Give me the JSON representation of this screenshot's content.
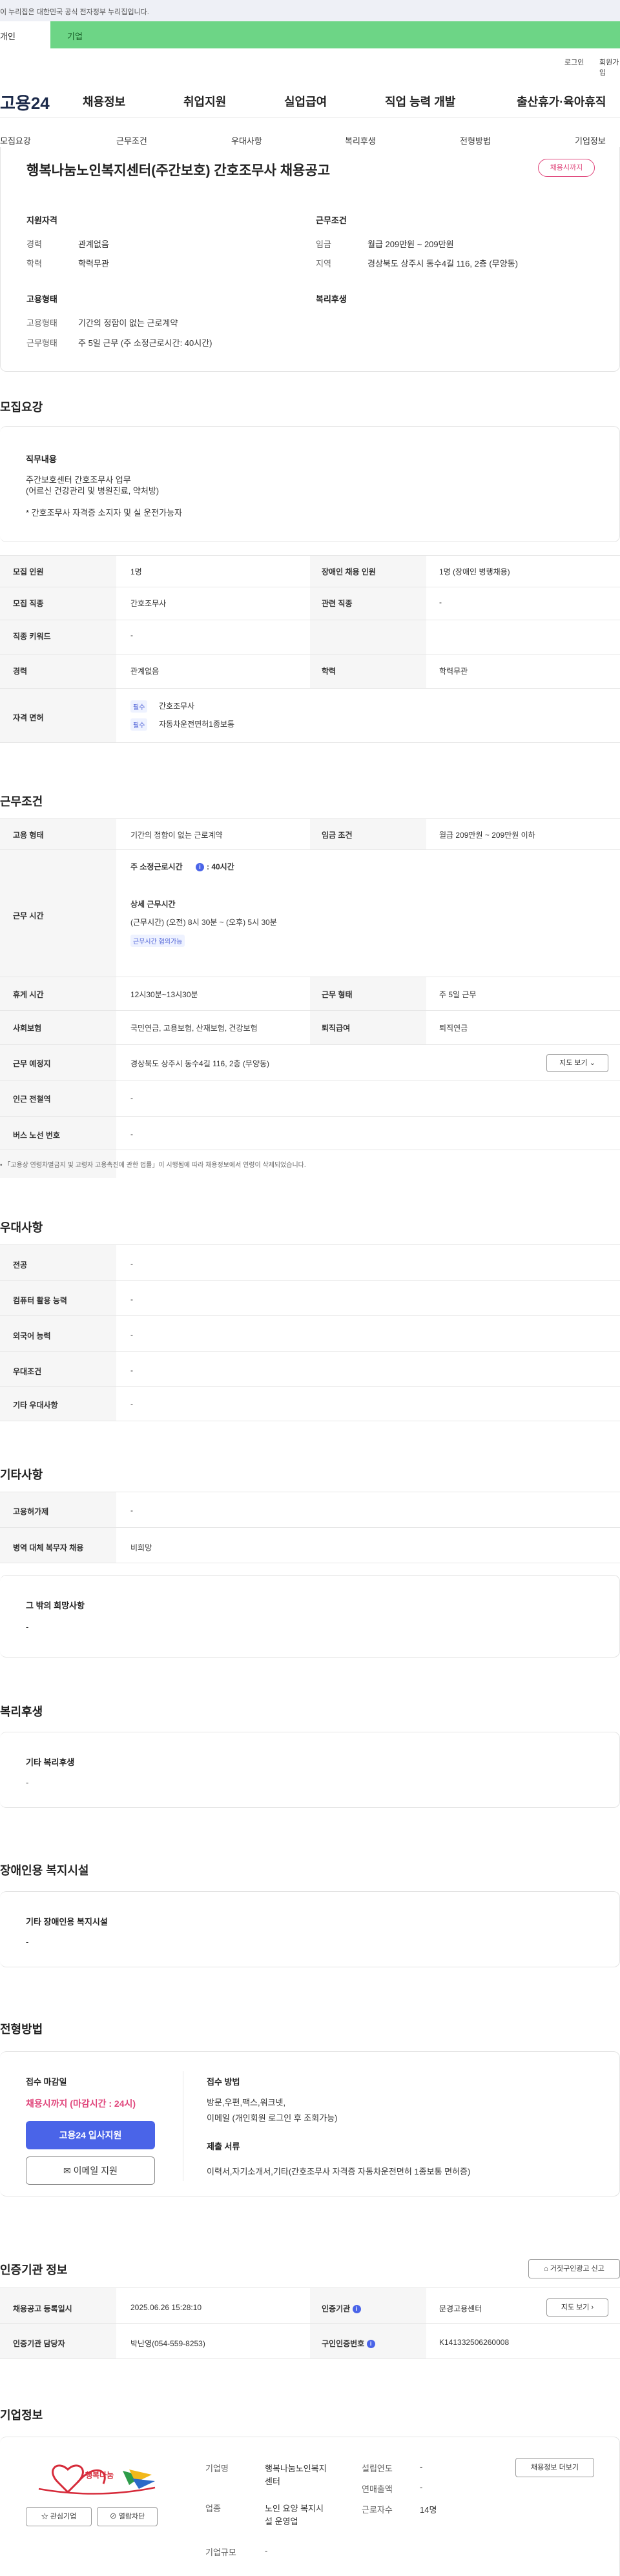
{
  "top_notice": "이 누리집은 대한민국 공식 전자정부 누리집입니다.",
  "tabs": {
    "personal": "개인",
    "company": "기업"
  },
  "util": {
    "login": "로그인",
    "join": "회원가입"
  },
  "logo": "고용24",
  "gnb": [
    "채용정보",
    "취업지원",
    "실업급여",
    "직업 능력 개발",
    "출산휴가·육아휴직"
  ],
  "subnav": [
    "모집요강",
    "근무조건",
    "우대사항",
    "복리후생",
    "전형방법",
    "기업정보"
  ],
  "job": {
    "title": "행복나눔노인복지센터(주간보호) 간호조무사 채용공고",
    "status_badge": "채용시까지",
    "qual_title": "지원자격",
    "career_label": "경력",
    "career_value": "관계없음",
    "edu_label": "학력",
    "edu_value": "학력무관",
    "emp_title": "고용형태",
    "emp_type_label": "고용형태",
    "emp_type_value": "기간의 정함이 없는 근로계약",
    "work_form_label": "근무형태",
    "work_form_value": "주 5일 근무 (주 소정근로시간: 40시간)",
    "cond_title": "근무조건",
    "wage_label": "임금",
    "wage_value": "월급 209만원 ~ 209만원",
    "region_label": "지역",
    "region_value": "경상북도 상주시 동수4길 116, 2층 (무양동)",
    "welfare_title": "복리후생"
  },
  "recruit": {
    "title": "모집요강",
    "duty_title": "직무내용",
    "duty_lines": [
      "주간보호센터 간호조무사 업무",
      "(어르신 건강관리 및 병원진료, 약처방)",
      "",
      "* 간호조무사 자격증 소지자 및 실 운전가능자"
    ],
    "rows": {
      "headcount_label": "모집 인원",
      "headcount_value": "1명",
      "disabled_label": "장애인 채용 인원",
      "disabled_value": "1명 (장애인 병행채용)",
      "job_label": "모집 직종",
      "job_value": "간호조무사",
      "related_label": "관련 직종",
      "related_value": "-",
      "keyword_label": "직종 키워드",
      "keyword_value": "-",
      "career_label": "경력",
      "career_value": "관계없음",
      "edu_label": "학력",
      "edu_value": "학력무관",
      "license_label": "자격 면허",
      "license_items": [
        {
          "badge": "필수",
          "name": "간호조무사"
        },
        {
          "badge": "필수",
          "name": "자동차운전면허1종보통"
        }
      ]
    }
  },
  "condition": {
    "title": "근무조건",
    "emp_label": "고용 형태",
    "emp_value": "기간의 정함이 없는 근로계약",
    "wage_label": "임금 조건",
    "wage_value": "월급 209만원 ~ 209만원 이하",
    "hours_label": "근무 시간",
    "weekly_hours_label": "주 소정근로시간",
    "weekly_hours_value": ": 40시간",
    "detail_label": "상세 근무시간",
    "detail_value": "(근무시간) (오전) 8시 30분 ~ (오후) 5시 30분",
    "consult_badge": "근무시간 협의가능",
    "rest_label": "휴게 시간",
    "rest_value": "12시30분~13시30분",
    "form_label": "근무 형태",
    "form_value": "주 5일 근무",
    "insurance_label": "사회보험",
    "insurance_value": "국민연금, 고용보험, 산재보험, 건강보험",
    "severance_label": "퇴직급여",
    "severance_value": "퇴직연금",
    "place_label": "근무 예정지",
    "place_value": "경상북도 상주시 동수4길 116, 2층 (무양동)",
    "map_button": "지도 보기",
    "subway_label": "인근 전철역",
    "subway_value": "-",
    "bus_label": "버스 노선 번호",
    "bus_value": "-",
    "notice": "「고용상 연령차별금지 및 고령자 고용촉진에 관한 법률」이 시행됨에 따라 채용정보에서 연령이 삭제되었습니다."
  },
  "preference": {
    "title": "우대사항",
    "rows": [
      {
        "label": "전공",
        "value": "-"
      },
      {
        "label": "컴퓨터 활용 능력",
        "value": "-"
      },
      {
        "label": "외국어 능력",
        "value": "-"
      },
      {
        "label": "우대조건",
        "value": "-"
      },
      {
        "label": "기타 우대사항",
        "value": "-"
      }
    ]
  },
  "etc": {
    "title": "기타사항",
    "rows": [
      {
        "label": "고용허가제",
        "value": "-"
      },
      {
        "label": "병역 대체 복무자 채용",
        "value": "비희망"
      }
    ],
    "wish_title": "그 밖의 희망사항",
    "wish_value": "-"
  },
  "welfare": {
    "title": "복리후생",
    "box_title": "기타 복리후생",
    "box_value": "-"
  },
  "disabled_facility": {
    "title": "장애인용 복지시설",
    "box_title": "기타 장애인용 복지시설",
    "box_value": "-"
  },
  "selection": {
    "title": "전형방법",
    "deadline_title": "접수 마감일",
    "deadline_value": "채용시까지 (마감시간 : 24시)",
    "apply_button": "고용24 입사지원",
    "email_button": "이메일 지원",
    "method_title": "접수 방법",
    "method_value_1": "방문,우편,팩스,워크넷,",
    "method_value_2": "이메일 (개인회원 로그인 후 조회가능)",
    "docs_title": "제출 서류",
    "docs_value": "이력서,자기소개서,기타(간호조무사 자격증 자동차운전면허 1종보통 면허증)"
  },
  "agency": {
    "title": "인증기관 정보",
    "report_button": "거짓구인광고 신고",
    "reg_date_label": "채용공고 등록일시",
    "reg_date_value": "2025.06.26 15:28:10",
    "agency_label": "인증기관",
    "agency_value": "문경고용센터",
    "map_button": "지도 보기",
    "manager_label": "인증기관 담당자",
    "manager_value": "박난영(054-559-8253)",
    "cert_label": "구인인증번호",
    "cert_value": "K141332506260008"
  },
  "company": {
    "title": "기업정보",
    "logo_text": "행복나눔",
    "interest_button": "관심기업",
    "block_button": "열람차단",
    "name_label": "기업명",
    "name_value_1": "행복나눔노인복지",
    "name_value_2": "센터",
    "industry_label": "업종",
    "industry_value_1": "노인 요양 복지시",
    "industry_value_2": "설 운영업",
    "size_label": "기업규모",
    "size_value": "-",
    "founded_label": "설립연도",
    "founded_value": "-",
    "revenue_label": "연매출액",
    "revenue_value": "-",
    "employees_label": "근로자수",
    "employees_value": "14명",
    "more_button": "채용정보 더보기"
  },
  "colors": {
    "brand": "#4a64e8",
    "accent_pink": "#e0457b",
    "company_tab": "#6dd586"
  }
}
